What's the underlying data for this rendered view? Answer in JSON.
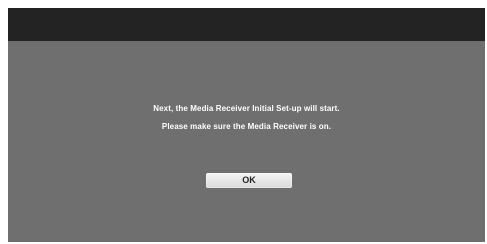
{
  "dialog": {
    "message_line1": "Next, the Media Receiver Initial Set-up will start.",
    "message_line2": "Please make sure the Media Receiver is on.",
    "ok_label": "OK"
  },
  "colors": {
    "screen_background": "#6f6f6f",
    "top_bar": "#232323",
    "text": "#ffffff",
    "button_background": "#e6e6e6",
    "button_text": "#222222"
  }
}
